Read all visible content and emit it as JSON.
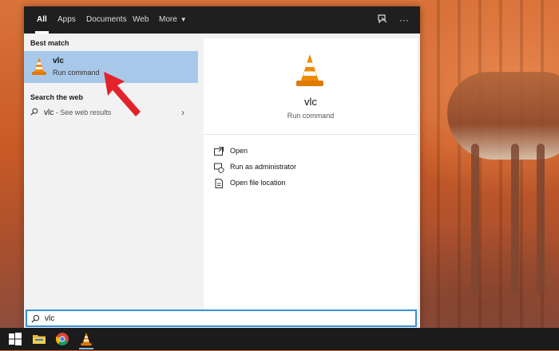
{
  "tabs": [
    {
      "label": "All",
      "active": true
    },
    {
      "label": "Apps",
      "active": false
    },
    {
      "label": "Documents",
      "active": false
    },
    {
      "label": "Web",
      "active": false
    },
    {
      "label": "More",
      "active": false
    }
  ],
  "bar_icons": [
    "feedback-icon",
    "more-options-icon"
  ],
  "left": {
    "best_match_heading": "Best match",
    "best_match": {
      "name": "vlc",
      "subtitle": "Run command",
      "icon": "vlc-cone-icon"
    },
    "web_heading": "Search the web",
    "web_result": {
      "term": "vlc",
      "suffix": " - See web results"
    }
  },
  "right": {
    "name": "vlc",
    "subtitle": "Run command",
    "actions": [
      {
        "label": "Open",
        "icon": "open-icon"
      },
      {
        "label": "Run as administrator",
        "icon": "run-as-admin-icon"
      },
      {
        "label": "Open file location",
        "icon": "file-location-icon"
      }
    ]
  },
  "search": {
    "value": "vlc"
  },
  "taskbar": [
    "start-icon",
    "file-explorer-icon",
    "chrome-icon",
    "vlc-taskbar-icon"
  ],
  "colors": {
    "selection": "#a8c8ea",
    "accent": "#3b8edb",
    "arrow": "#e3232b",
    "vlc_orange": "#f08a00"
  }
}
